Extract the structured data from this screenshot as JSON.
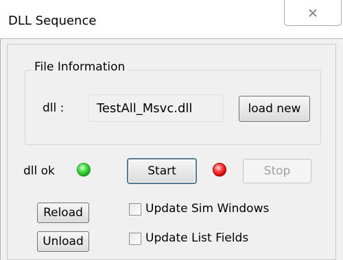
{
  "window": {
    "title": "DLL Sequence",
    "close_icon": "close-icon"
  },
  "file_info": {
    "group_label": "File Information",
    "dll_label": "dll :",
    "dll_value": "TestAll_Msvc.dll",
    "load_new_label": "load new"
  },
  "status": {
    "dll_ok_label": "dll ok",
    "dll_ok_led_color": "#22cc22",
    "running_led_color": "#e00000"
  },
  "controls": {
    "start_label": "Start",
    "stop_label": "Stop",
    "stop_enabled": false,
    "reload_label": "Reload",
    "unload_label": "Unload"
  },
  "options": {
    "update_sim_windows_label": "Update Sim Windows",
    "update_sim_windows_checked": false,
    "update_list_fields_label": "Update List Fields",
    "update_list_fields_checked": false
  }
}
